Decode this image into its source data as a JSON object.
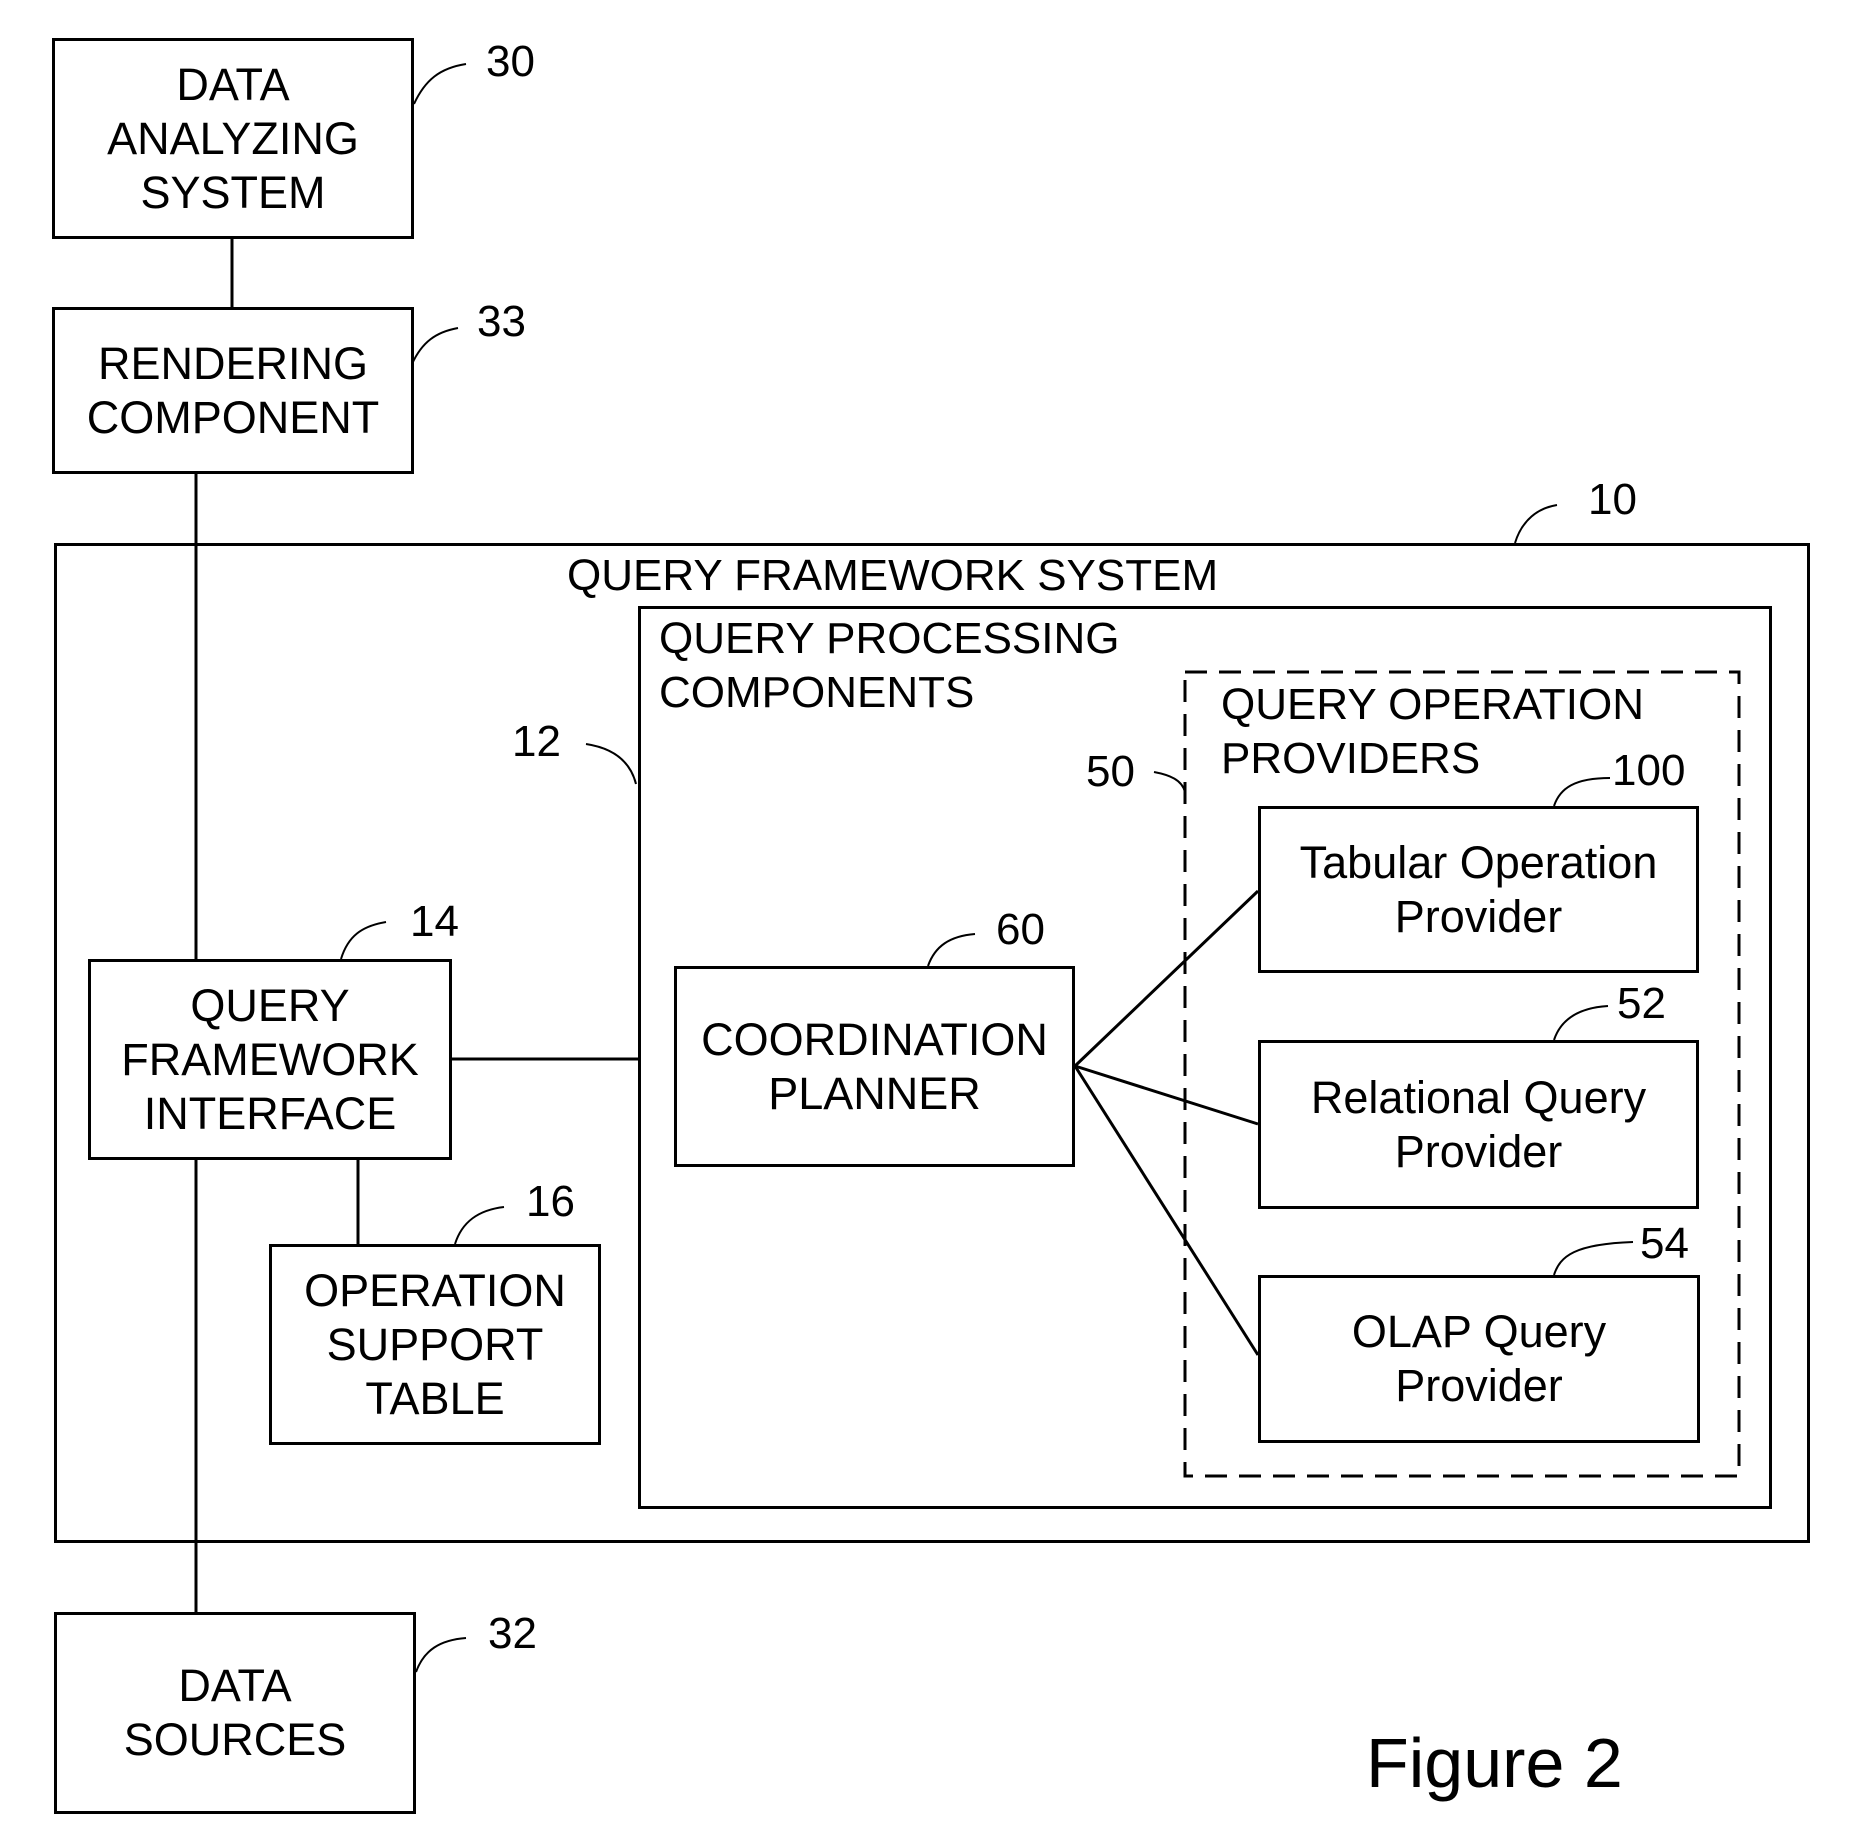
{
  "figure": {
    "caption": "Figure 2",
    "boxes": {
      "data_analyzing_system": {
        "label": "DATA\nANALYZING\nSYSTEM",
        "ref": "30"
      },
      "rendering_component": {
        "label": "RENDERING\nCOMPONENT",
        "ref": "33"
      },
      "query_framework_system": {
        "label": "QUERY FRAMEWORK SYSTEM",
        "ref": "10"
      },
      "query_processing_components": {
        "label": "QUERY PROCESSING\nCOMPONENTS",
        "ref": "12"
      },
      "query_operation_providers": {
        "label": "QUERY OPERATION\nPROVIDERS",
        "ref": "50"
      },
      "query_framework_interface": {
        "label": "QUERY\nFRAMEWORK\nINTERFACE",
        "ref": "14"
      },
      "operation_support_table": {
        "label": "OPERATION\nSUPPORT\nTABLE",
        "ref": "16"
      },
      "coordination_planner": {
        "label": "COORDINATION\nPLANNER",
        "ref": "60"
      },
      "tabular_operation_provider": {
        "label": "Tabular Operation\nProvider",
        "ref": "100"
      },
      "relational_query_provider": {
        "label": "Relational Query\nProvider",
        "ref": "52"
      },
      "olap_query_provider": {
        "label": "OLAP Query\nProvider",
        "ref": "54"
      },
      "data_sources": {
        "label": "DATA\nSOURCES",
        "ref": "32"
      }
    }
  }
}
